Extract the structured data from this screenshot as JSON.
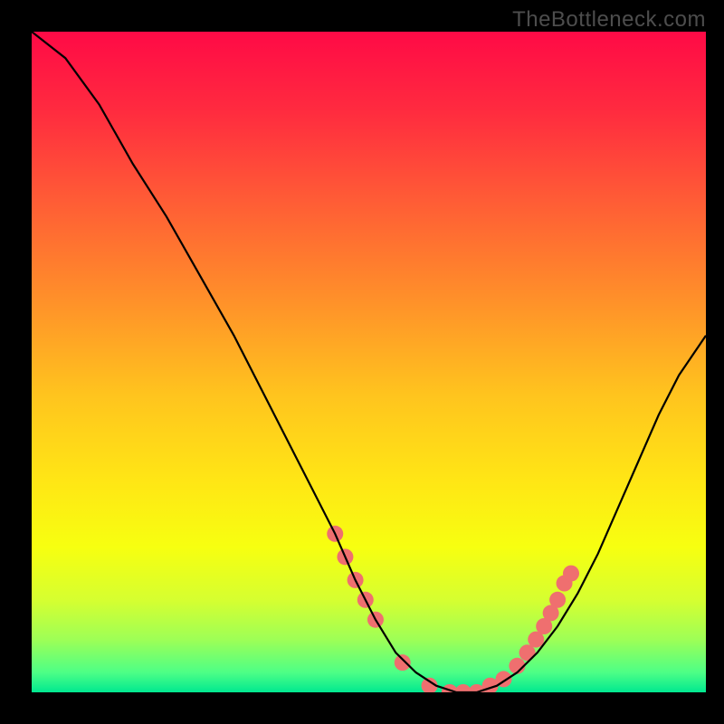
{
  "watermark": "TheBottleneck.com",
  "chart_data": {
    "type": "line",
    "title": "",
    "xlabel": "",
    "ylabel": "",
    "xlim": [
      0,
      100
    ],
    "ylim": [
      0,
      100
    ],
    "grid": false,
    "legend": false,
    "background_gradient": {
      "stops": [
        {
          "pos": 0.0,
          "color": "#ff0a46"
        },
        {
          "pos": 0.12,
          "color": "#ff2b3f"
        },
        {
          "pos": 0.25,
          "color": "#ff5a36"
        },
        {
          "pos": 0.4,
          "color": "#ff8e2a"
        },
        {
          "pos": 0.55,
          "color": "#ffc41e"
        },
        {
          "pos": 0.68,
          "color": "#ffe615"
        },
        {
          "pos": 0.78,
          "color": "#f7ff10"
        },
        {
          "pos": 0.86,
          "color": "#d6ff30"
        },
        {
          "pos": 0.92,
          "color": "#9eff56"
        },
        {
          "pos": 0.97,
          "color": "#4dff86"
        },
        {
          "pos": 1.0,
          "color": "#00e890"
        }
      ]
    },
    "series": [
      {
        "name": "bottleneck-curve",
        "type": "line",
        "color": "#000000",
        "x": [
          0,
          5,
          10,
          15,
          20,
          25,
          30,
          35,
          40,
          45,
          48,
          51,
          54,
          57,
          60,
          63,
          66,
          69,
          72,
          75,
          78,
          81,
          84,
          87,
          90,
          93,
          96,
          100
        ],
        "y": [
          100,
          96,
          89,
          80,
          72,
          63,
          54,
          44,
          34,
          24,
          17,
          11,
          6,
          3,
          1,
          0,
          0,
          1,
          3,
          6,
          10,
          15,
          21,
          28,
          35,
          42,
          48,
          54
        ]
      },
      {
        "name": "highlight-dots",
        "type": "scatter",
        "color": "#ef6f6f",
        "radius": 9,
        "x": [
          45,
          46.5,
          48,
          49.5,
          51,
          55,
          59,
          62,
          64,
          66,
          68,
          70,
          72,
          73.5,
          74.8,
          76,
          77,
          78,
          79,
          80
        ],
        "y": [
          24,
          20.5,
          17,
          14,
          11,
          4.5,
          1,
          0,
          0,
          0,
          1,
          2,
          4,
          6,
          8,
          10,
          12,
          14,
          16.5,
          18
        ]
      }
    ]
  }
}
